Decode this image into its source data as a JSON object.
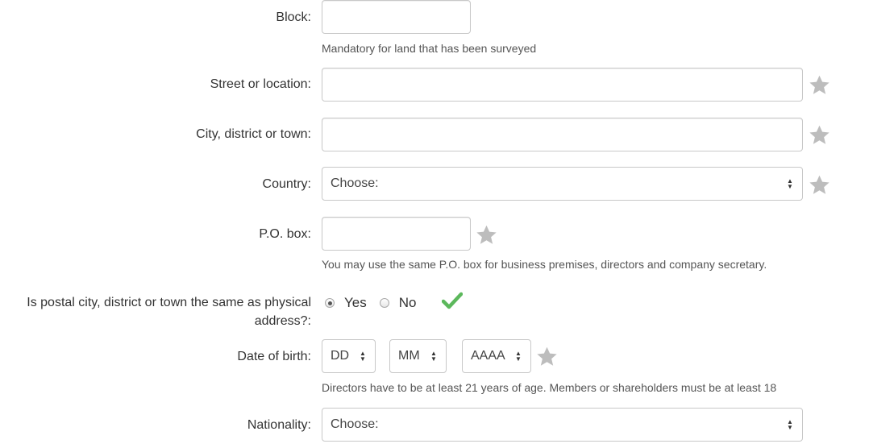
{
  "colors": {
    "star": "#bdbdbd",
    "check": "#5cb85c",
    "border": "#c8c8c8"
  },
  "form": {
    "block": {
      "label": "Block:",
      "value": "",
      "help": "Mandatory for land that has been surveyed"
    },
    "street": {
      "label": "Street or location:",
      "value": ""
    },
    "city": {
      "label": "City, district or town:",
      "value": ""
    },
    "country": {
      "label": "Country:",
      "selected": "Choose:"
    },
    "po_box": {
      "label": "P.O. box:",
      "value": "",
      "help": "You may use the same P.O. box for business premises, directors and company secretary."
    },
    "postal_same": {
      "label": "Is postal city, district or town the same as physical address?:",
      "options": [
        "Yes",
        "No"
      ],
      "selected": "Yes"
    },
    "dob": {
      "label": "Date of birth:",
      "day": "DD",
      "month": "MM",
      "year": "AAAA",
      "help": "Directors have to be at least 21 years of age. Members or shareholders must be at least 18"
    },
    "nationality": {
      "label": "Nationality:",
      "selected": "Choose:"
    }
  }
}
